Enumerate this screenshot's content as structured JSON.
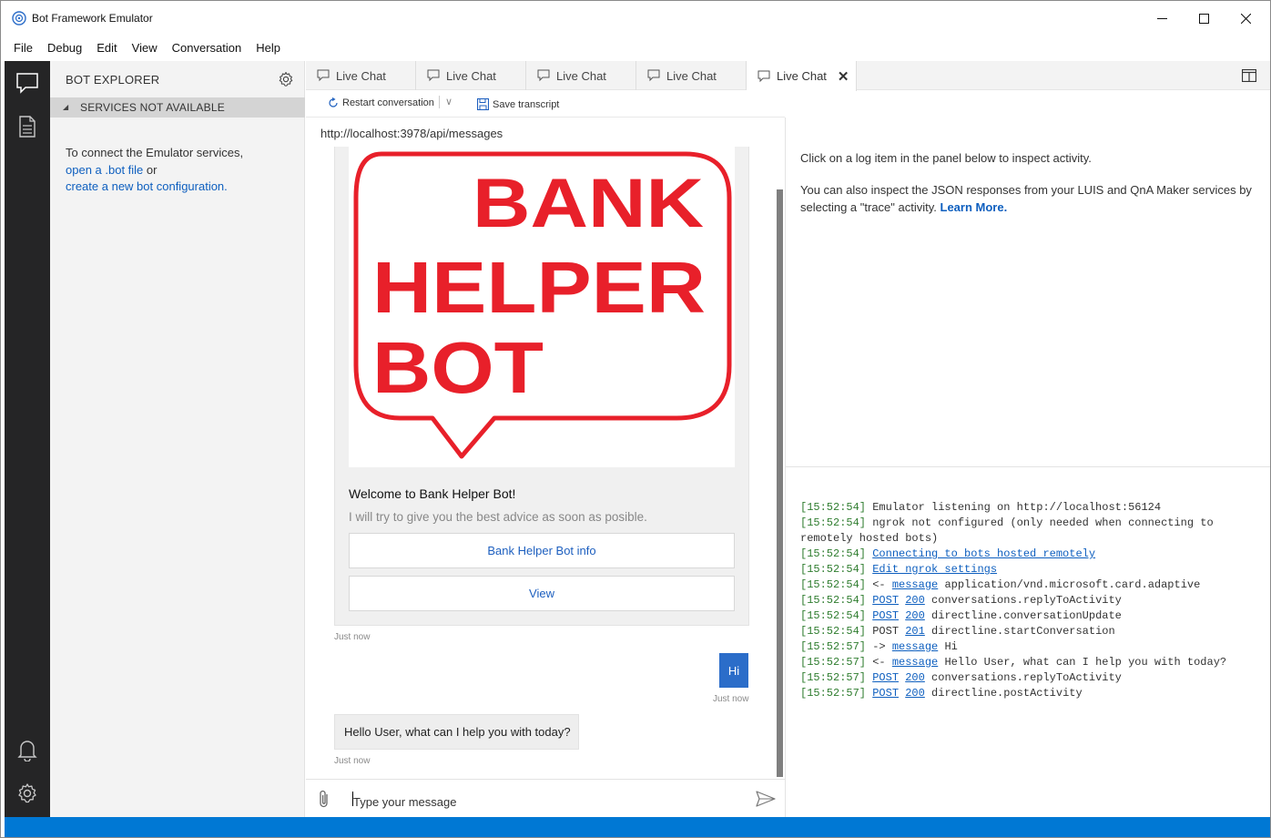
{
  "window": {
    "title": "Bot Framework Emulator"
  },
  "menu": [
    "File",
    "Debug",
    "Edit",
    "View",
    "Conversation",
    "Help"
  ],
  "explorer": {
    "title": "BOT EXPLORER",
    "section": "SERVICES NOT AVAILABLE",
    "text_1": "To connect the Emulator services,",
    "link_open": "open a .bot file",
    "text_or": "or",
    "link_create": "create a new bot configuration."
  },
  "tabs": [
    {
      "label": "Live Chat"
    },
    {
      "label": "Live Chat"
    },
    {
      "label": "Live Chat"
    },
    {
      "label": "Live Chat"
    },
    {
      "label": "Live Chat",
      "close": "✕"
    }
  ],
  "toolbar": {
    "restart": "Restart conversation",
    "chevron": "∨",
    "save": "Save transcript"
  },
  "chat": {
    "endpoint": "http://localhost:3978/api/messages",
    "card_image_text": [
      "BANK",
      "HELPER",
      "BOT"
    ],
    "card_title": "Welcome to Bank Helper Bot!",
    "card_subtitle": "I will try to give you the best advice as soon as posible.",
    "card_button_1": "Bank Helper Bot info",
    "card_button_2": "View",
    "timestamp_1": "Just now",
    "user_message": "Hi",
    "timestamp_2": "Just now",
    "bot_message": "Hello User, what can I help you with today?",
    "timestamp_3": "Just now",
    "input_placeholder": "Type your message"
  },
  "inspector": {
    "line1": "Click on a log item in the panel below to inspect activity.",
    "line2": "You can also inspect the JSON responses from your LUIS and QnA Maker services by selecting a \"trace\" activity.",
    "learn_more": "Learn More."
  },
  "log": [
    {
      "time": "[15:52:54]",
      "parts": [
        {
          "t": " Emulator listening on http://localhost:56124",
          "link": false
        }
      ]
    },
    {
      "time": "[15:52:54]",
      "parts": [
        {
          "t": " ngrok not configured (only needed when connecting to remotely hosted bots)",
          "link": false
        }
      ]
    },
    {
      "time": "[15:52:54]",
      "parts": [
        {
          "t": " ",
          "link": false
        },
        {
          "t": "Connecting to bots hosted remotely",
          "link": true
        }
      ]
    },
    {
      "time": "[15:52:54]",
      "parts": [
        {
          "t": " ",
          "link": false
        },
        {
          "t": "Edit ngrok settings",
          "link": true
        }
      ]
    },
    {
      "time": "[15:52:54]",
      "parts": [
        {
          "t": " <- ",
          "link": false
        },
        {
          "t": "message",
          "link": true
        },
        {
          "t": " application/vnd.microsoft.card.adaptive",
          "link": false
        }
      ]
    },
    {
      "time": "[15:52:54]",
      "parts": [
        {
          "t": " ",
          "link": false
        },
        {
          "t": "POST",
          "link": true
        },
        {
          "t": " ",
          "link": false
        },
        {
          "t": "200",
          "link": true
        },
        {
          "t": " conversations.replyToActivity",
          "link": false
        }
      ]
    },
    {
      "time": "[15:52:54]",
      "parts": [
        {
          "t": " ",
          "link": false
        },
        {
          "t": "POST",
          "link": true
        },
        {
          "t": " ",
          "link": false
        },
        {
          "t": "200",
          "link": true
        },
        {
          "t": " directline.conversationUpdate",
          "link": false
        }
      ]
    },
    {
      "time": "[15:52:54]",
      "parts": [
        {
          "t": " POST ",
          "link": false
        },
        {
          "t": "201",
          "link": true
        },
        {
          "t": " directline.startConversation",
          "link": false
        }
      ]
    },
    {
      "time": "[15:52:57]",
      "parts": [
        {
          "t": " -> ",
          "link": false
        },
        {
          "t": "message",
          "link": true
        },
        {
          "t": " Hi",
          "link": false
        }
      ]
    },
    {
      "time": "[15:52:57]",
      "parts": [
        {
          "t": " <- ",
          "link": false
        },
        {
          "t": "message",
          "link": true
        },
        {
          "t": " Hello User, what can I help you with today?",
          "link": false
        }
      ]
    },
    {
      "time": "[15:52:57]",
      "parts": [
        {
          "t": " ",
          "link": false
        },
        {
          "t": "POST",
          "link": true
        },
        {
          "t": " ",
          "link": false
        },
        {
          "t": "200",
          "link": true
        },
        {
          "t": " conversations.replyToActivity",
          "link": false
        }
      ]
    },
    {
      "time": "[15:52:57]",
      "parts": [
        {
          "t": " ",
          "link": false
        },
        {
          "t": "POST",
          "link": true
        },
        {
          "t": " ",
          "link": false
        },
        {
          "t": "200",
          "link": true
        },
        {
          "t": " directline.postActivity",
          "link": false
        }
      ]
    }
  ],
  "icons": {
    "app": "bot-framework-icon",
    "minimize": "minimize-icon",
    "maximize": "maximize-icon",
    "close": "close-icon",
    "chat": "chat-icon",
    "document": "document-icon",
    "bell": "bell-icon",
    "settings": "gear-icon",
    "split": "split-view-icon",
    "restart": "restart-icon",
    "save": "save-icon",
    "attach": "paperclip-icon",
    "send": "send-icon"
  },
  "colors": {
    "accent": "#0078d4",
    "activity_bar": "#252526",
    "user_bubble": "#2b6dc9",
    "logo_red": "#e8202a",
    "log_time": "#2f7d2f",
    "link": "#0e5fbf"
  }
}
